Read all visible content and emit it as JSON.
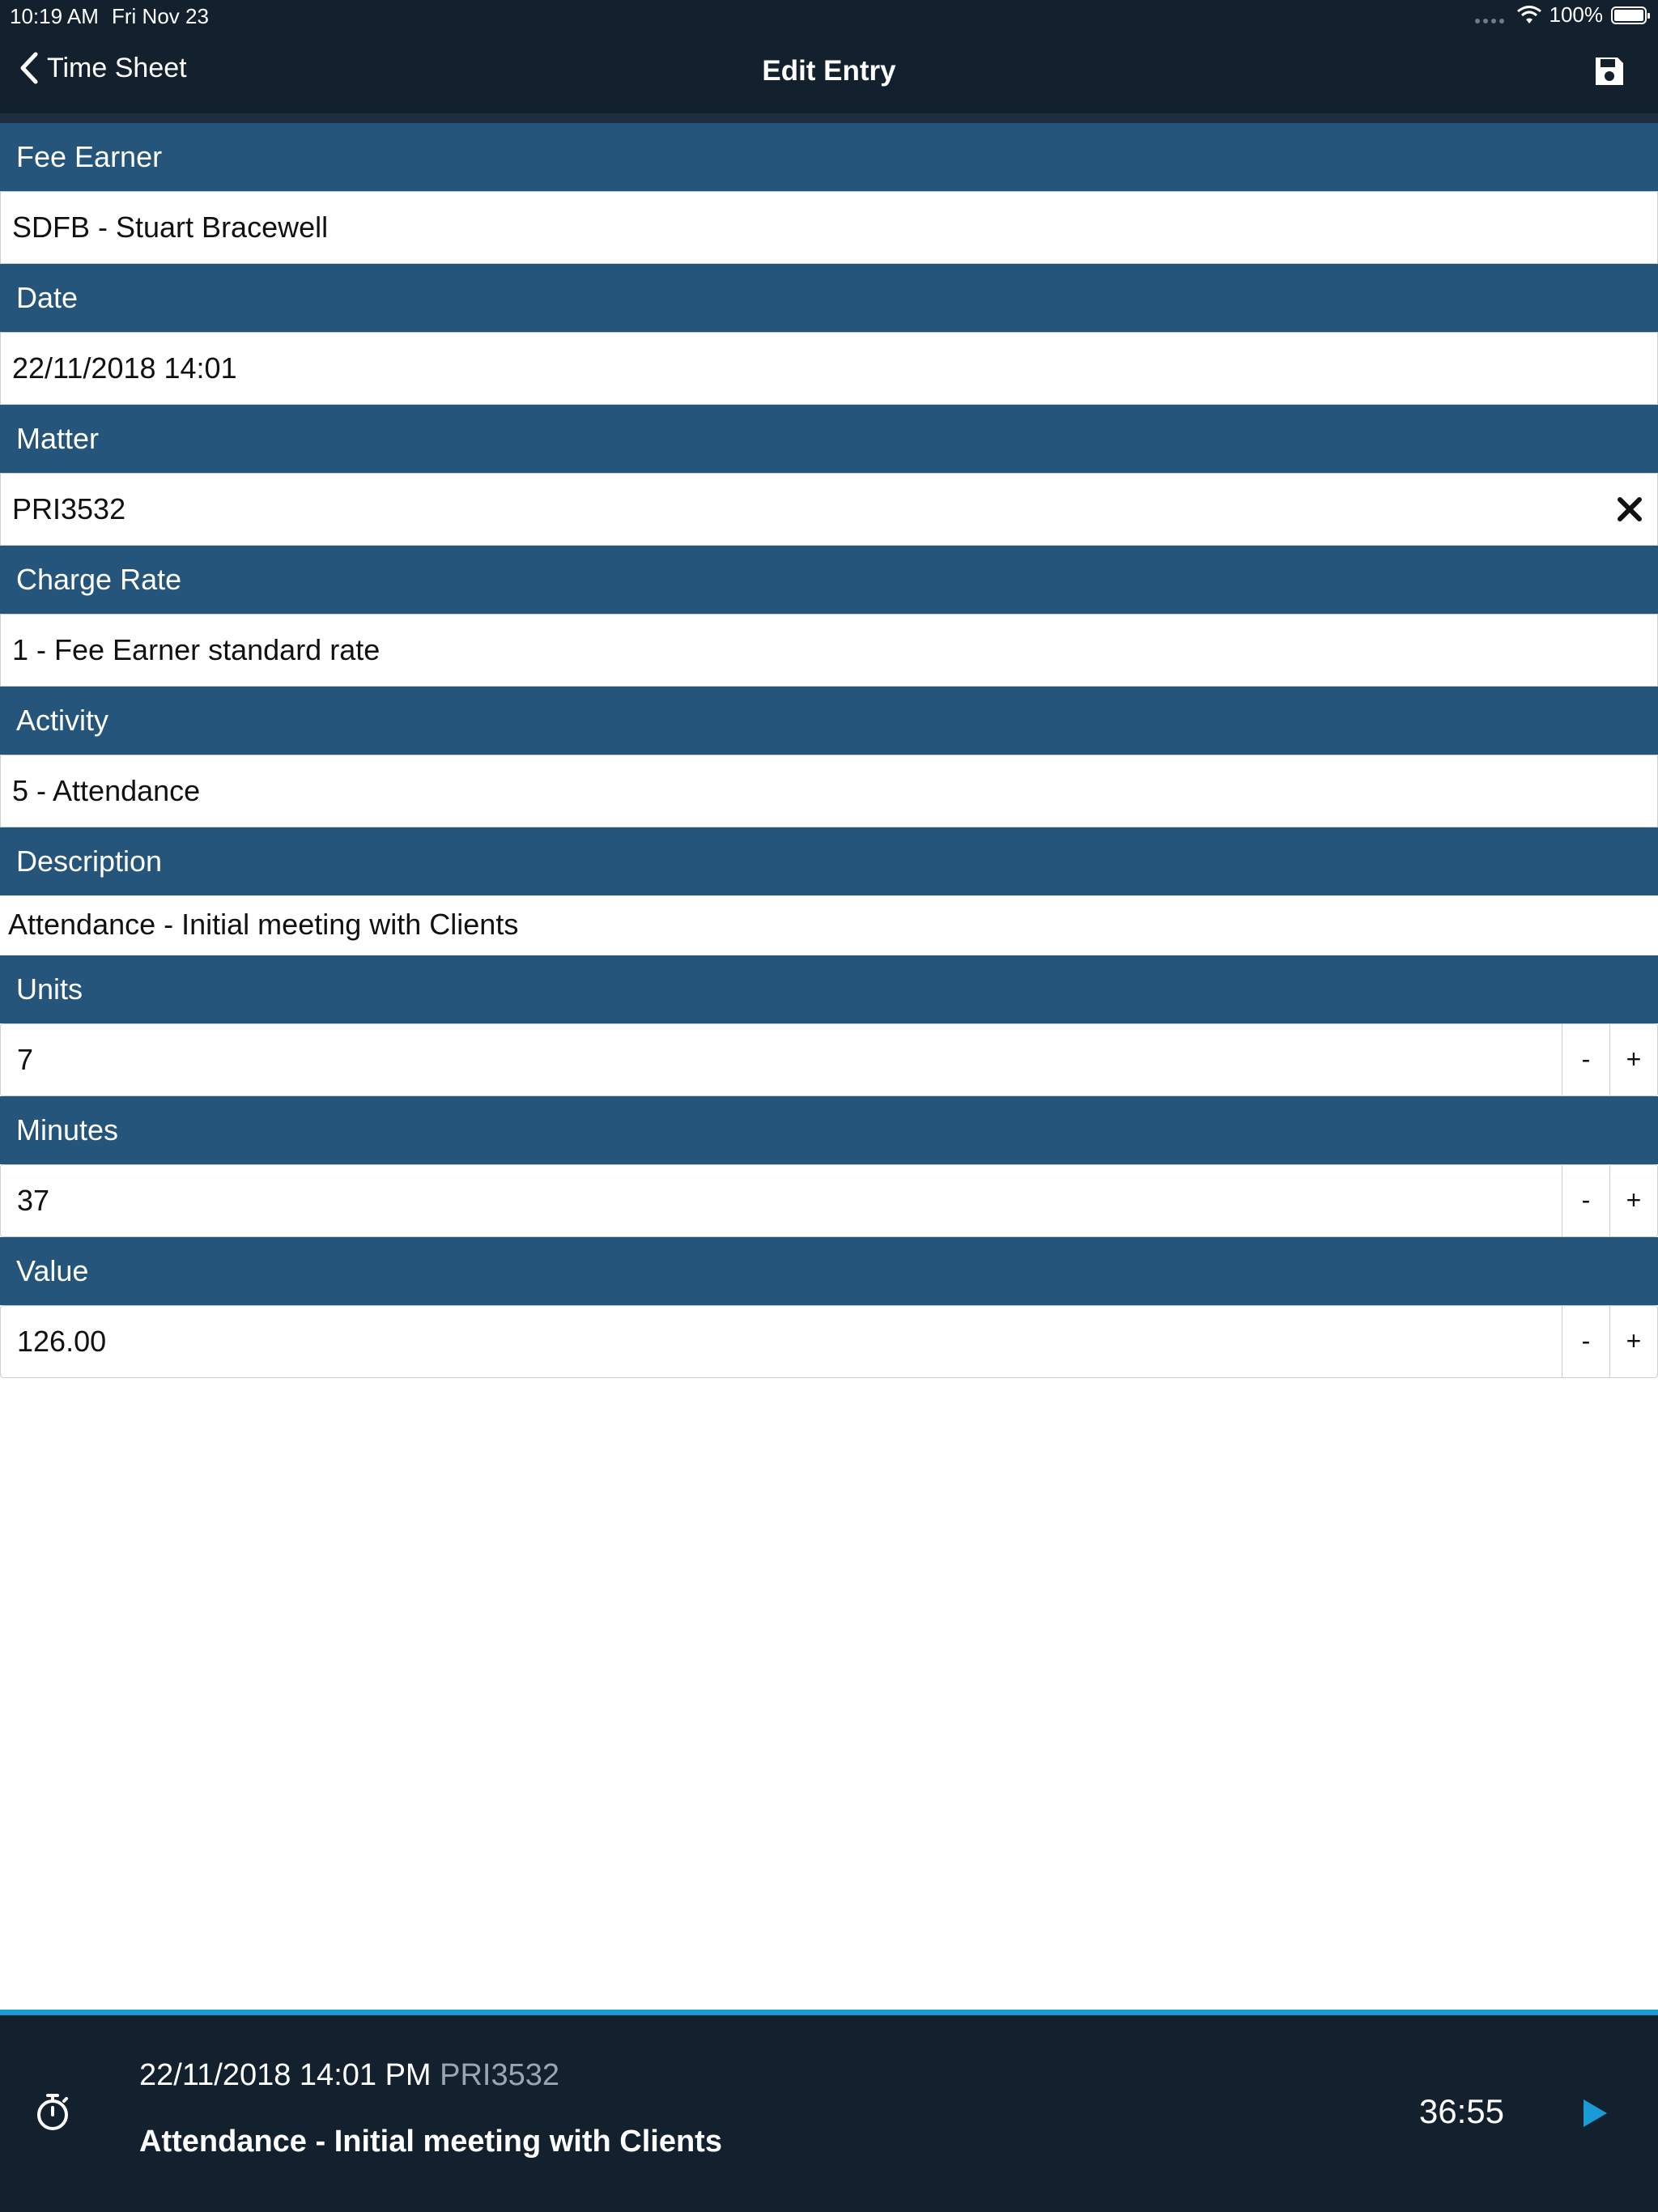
{
  "status": {
    "time": "10:19 AM",
    "date": "Fri Nov 23",
    "battery": "100%"
  },
  "nav": {
    "back_label": "Time Sheet",
    "title": "Edit Entry"
  },
  "form": {
    "fee_earner": {
      "label": "Fee Earner",
      "value": "SDFB - Stuart Bracewell"
    },
    "date": {
      "label": "Date",
      "value": "22/11/2018 14:01"
    },
    "matter": {
      "label": "Matter",
      "value": "PRI3532"
    },
    "charge_rate": {
      "label": "Charge Rate",
      "value": "1 - Fee Earner standard rate"
    },
    "activity": {
      "label": "Activity",
      "value": "5 - Attendance"
    },
    "description": {
      "label": "Description",
      "value": "Attendance - Initial meeting with Clients"
    },
    "units": {
      "label": "Units",
      "value": "7"
    },
    "minutes": {
      "label": "Minutes",
      "value": "37"
    },
    "value": {
      "label": "Value",
      "value": "126.00"
    },
    "minus_label": "-",
    "plus_label": "+"
  },
  "timer_bar": {
    "datetime": "22/11/2018 14:01 PM",
    "matter": "PRI3532",
    "description": "Attendance - Initial meeting with Clients",
    "elapsed": "36:55"
  },
  "colors": {
    "header_bg": "#13212e",
    "section_bg": "#25557a",
    "accent": "#1a9bd6"
  },
  "icons": {
    "back": "chevron-left-icon",
    "save": "floppy-disk-icon",
    "clear": "close-icon",
    "timer": "stopwatch-icon",
    "play": "play-icon"
  }
}
